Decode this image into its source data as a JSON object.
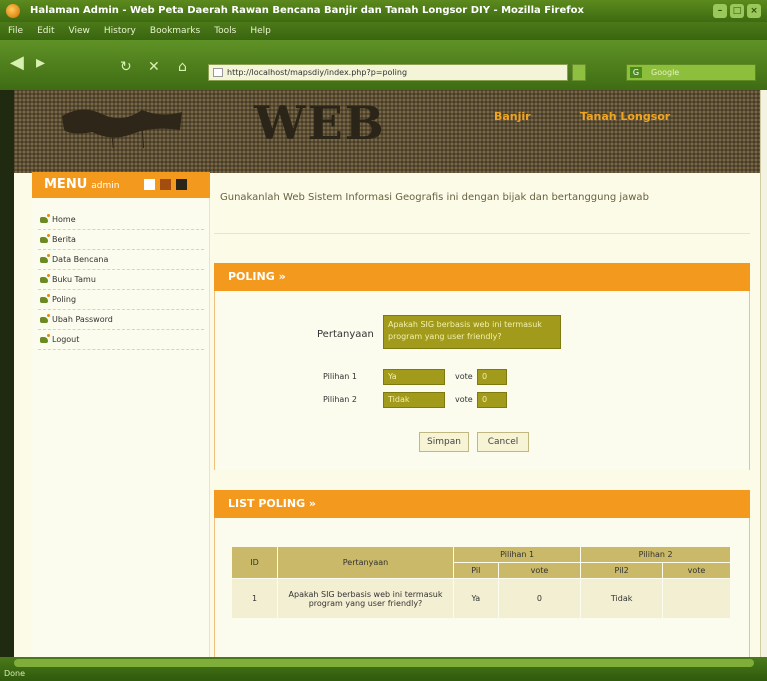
{
  "window": {
    "title": "Halaman Admin - Web Peta Daerah Rawan Bencana Banjir dan Tanah Longsor DIY - Mozilla Firefox",
    "controls": [
      "–",
      "□",
      "×"
    ]
  },
  "menubar": [
    "File",
    "Edit",
    "View",
    "History",
    "Bookmarks",
    "Tools",
    "Help"
  ],
  "nav": {
    "url": "http://localhost/mapsdiy/index.php?p=poling",
    "search_placeholder": "Google"
  },
  "header": {
    "title": "WEB",
    "links": [
      "Banjir",
      "Tanah Longsor"
    ]
  },
  "sidebar": {
    "heading": "MENU",
    "heading_sub": "admin",
    "items": [
      "Home",
      "Berita",
      "Data Bencana",
      "Buku Tamu",
      "Poling",
      "Ubah Password",
      "Logout"
    ]
  },
  "welcome_text": "Gunakanlah Web Sistem Informasi Geografis ini dengan bijak dan bertanggung jawab",
  "poling_form": {
    "heading": "POLING »",
    "question_label": "Pertanyaan",
    "question_value": "Apakah SIG berbasis web ini termasuk program yang user friendly?",
    "option1_label": "Pilihan 1",
    "option1_value": "Ya",
    "option1_vote_label": "vote",
    "option1_vote": "0",
    "option2_label": "Pilihan 2",
    "option2_value": "Tidak",
    "option2_vote_label": "vote",
    "option2_vote": "0",
    "save_label": "Simpan",
    "cancel_label": "Cancel"
  },
  "list_poling": {
    "heading": "LIST POLING »",
    "col_id": "ID",
    "col_question": "Pertanyaan",
    "col_option1": "Pilihan 1",
    "col_option2": "Pilihan 2",
    "sub_pil": "Pil",
    "sub_vote": "vote",
    "sub_pil2": "Pil2",
    "sub_vote2": "vote",
    "rows": [
      {
        "id": "1",
        "question": "Apakah SIG berbasis web ini termasuk program yang user friendly?",
        "pil1": "Ya",
        "vote1": "0",
        "pil2": "Tidak",
        "vote2": ""
      }
    ]
  },
  "status": "Done",
  "colors": {
    "accent": "#f39a1e",
    "field": "#a19a1b",
    "chrome": "#4c7a18"
  }
}
